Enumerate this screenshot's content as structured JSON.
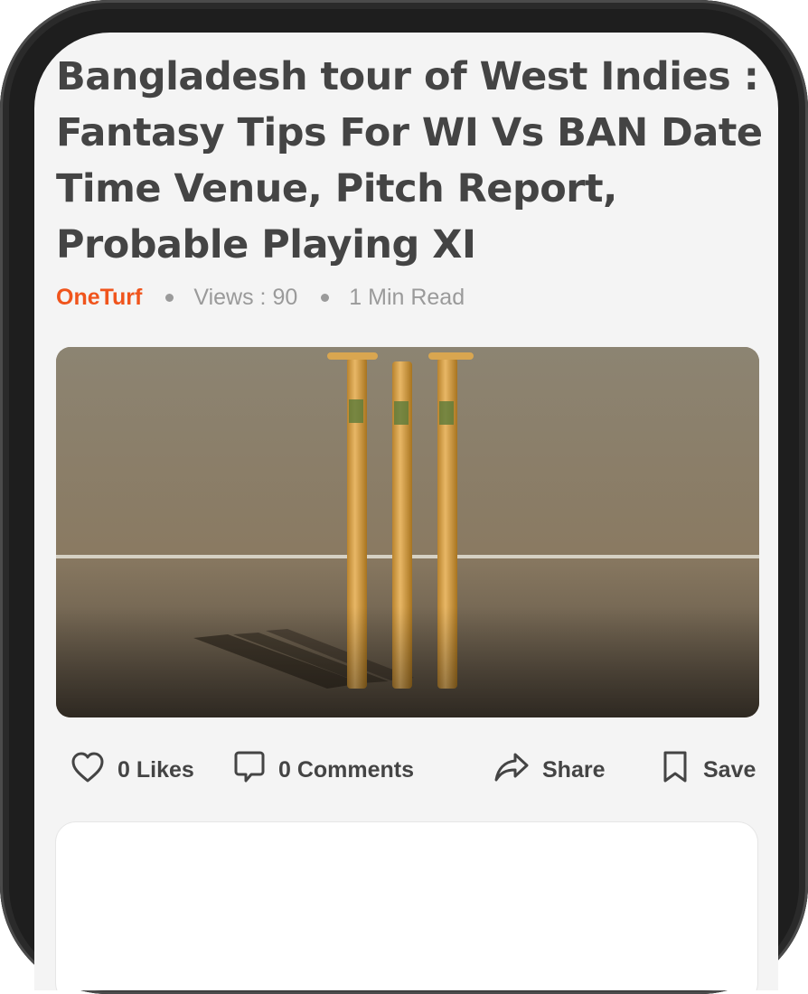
{
  "article": {
    "title": "Bangladesh tour of West Indies : Fantasy Tips For WI Vs BAN Date Time Venue, Pitch Report, Probable Playing XI",
    "author": "OneTurf",
    "views": "Views : 90",
    "read_time": "1 Min Read"
  },
  "hero_image": {
    "subject": "cricket stumps on pitch"
  },
  "actions": {
    "likes": "0 Likes",
    "comments": "0 Comments",
    "share": "Share",
    "save": "Save"
  },
  "colors": {
    "accent": "#f0541c",
    "title_text": "#444444",
    "meta_text": "#9a9a9a",
    "screen_bg": "#f4f4f4"
  }
}
